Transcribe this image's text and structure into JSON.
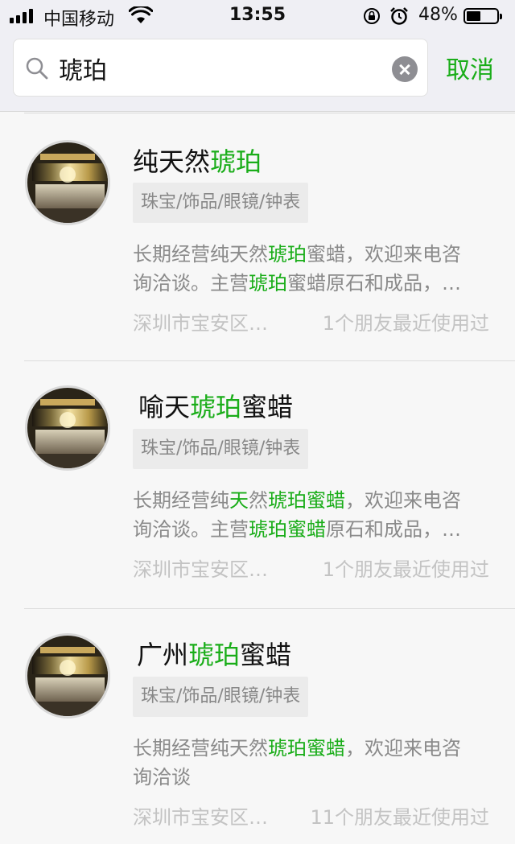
{
  "status_bar": {
    "carrier": "中国移动",
    "time": "13:55",
    "battery_percent": "48%",
    "battery_level": 0.48
  },
  "search": {
    "query": "琥珀",
    "cancel_label": "取消",
    "icons": [
      "search-icon",
      "clear-icon"
    ]
  },
  "results": [
    {
      "title_parts": [
        {
          "text": "纯天然",
          "hl": false
        },
        {
          "text": "琥珀",
          "hl": true
        }
      ],
      "category": "珠宝/饰品/眼镜/钟表",
      "desc_line1": [
        {
          "text": "长期经营纯天然",
          "hl": false
        },
        {
          "text": "琥珀",
          "hl": true
        },
        {
          "text": "蜜蜡，欢迎来电咨",
          "hl": false
        }
      ],
      "desc_line2": [
        {
          "text": "询洽谈。主营",
          "hl": false
        },
        {
          "text": "琥珀",
          "hl": true
        },
        {
          "text": "蜜蜡原石和成品，…",
          "hl": false
        }
      ],
      "location": "深圳市宝安区…",
      "friends": "1个朋友最近使用过"
    },
    {
      "title_parts": [
        {
          "text": "喻天",
          "hl": false
        },
        {
          "text": "琥珀",
          "hl": true
        },
        {
          "text": "蜜蜡",
          "hl": false
        }
      ],
      "category": "珠宝/饰品/眼镜/钟表",
      "desc_line1": [
        {
          "text": "长期经营纯",
          "hl": false
        },
        {
          "text": "天",
          "hl": true
        },
        {
          "text": "然",
          "hl": false
        },
        {
          "text": "琥珀蜜蜡",
          "hl": true
        },
        {
          "text": "，欢迎来电咨",
          "hl": false
        }
      ],
      "desc_line2": [
        {
          "text": "询洽谈。主营",
          "hl": false
        },
        {
          "text": "琥珀蜜蜡",
          "hl": true
        },
        {
          "text": "原石和成品，…",
          "hl": false
        }
      ],
      "location": "深圳市宝安区…",
      "friends": "1个朋友最近使用过"
    },
    {
      "title_parts": [
        {
          "text": "广州",
          "hl": false
        },
        {
          "text": "琥珀",
          "hl": true
        },
        {
          "text": "蜜蜡",
          "hl": false
        }
      ],
      "category": "珠宝/饰品/眼镜/钟表",
      "desc_line1": [
        {
          "text": "长期经营纯天然",
          "hl": false
        },
        {
          "text": "琥珀蜜蜡",
          "hl": true
        },
        {
          "text": "，欢迎来电咨",
          "hl": false
        }
      ],
      "desc_line2": [
        {
          "text": "询洽谈",
          "hl": false
        }
      ],
      "location": "深圳市宝安区…",
      "friends": "11个朋友最近使用过"
    }
  ]
}
